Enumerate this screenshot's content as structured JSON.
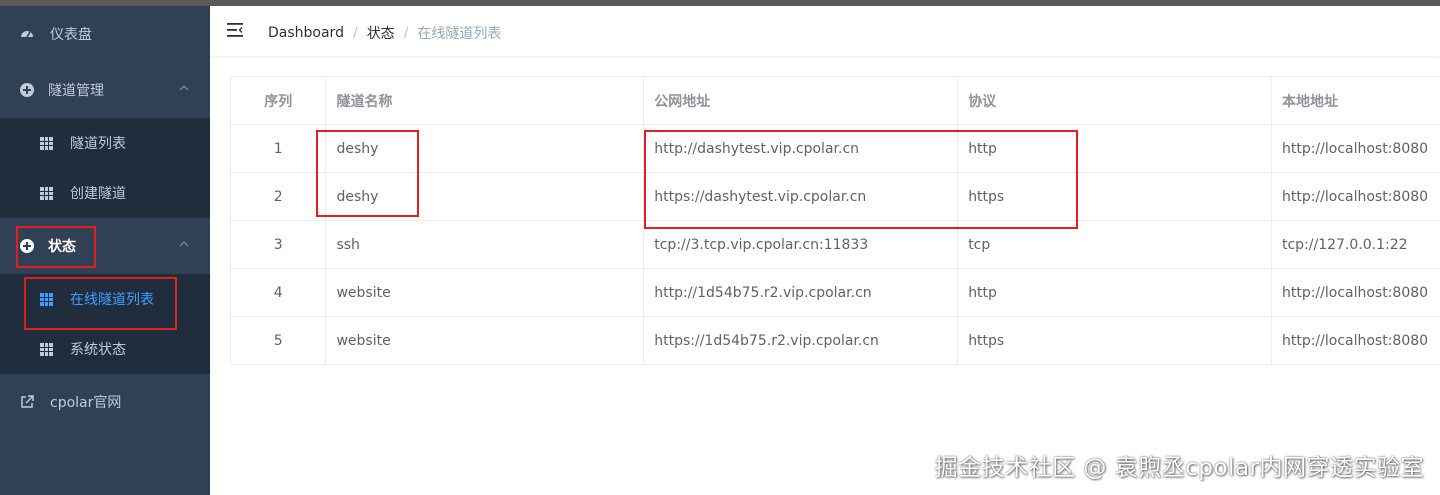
{
  "sidebar": {
    "dashboard": "仪表盘",
    "tunnel_mgmt": "隧道管理",
    "tunnel_list": "隧道列表",
    "create_tunnel": "创建隧道",
    "status": "状态",
    "online_tunnels": "在线隧道列表",
    "system_status": "系统状态",
    "cpolar_site": "cpolar官网"
  },
  "breadcrumb": {
    "home": "Dashboard",
    "sep": "/",
    "level1": "状态",
    "current": "在线隧道列表"
  },
  "table": {
    "headers": [
      "序列",
      "隧道名称",
      "公网地址",
      "协议",
      "本地地址"
    ],
    "rows": [
      [
        "1",
        "deshy",
        "http://dashytest.vip.cpolar.cn",
        "http",
        "http://localhost:8080"
      ],
      [
        "2",
        "deshy",
        "https://dashytest.vip.cpolar.cn",
        "https",
        "http://localhost:8080"
      ],
      [
        "3",
        "ssh",
        "tcp://3.tcp.vip.cpolar.cn:11833",
        "tcp",
        "tcp://127.0.0.1:22"
      ],
      [
        "4",
        "website",
        "http://1d54b75.r2.vip.cpolar.cn",
        "http",
        "http://localhost:8080"
      ],
      [
        "5",
        "website",
        "https://1d54b75.r2.vip.cpolar.cn",
        "https",
        "http://localhost:8080"
      ]
    ]
  },
  "watermark": "掘金技术社区 @ 袁煦丞cpolar内网穿透实验室",
  "colors": {
    "sidebar_bg": "#304156",
    "submenu_bg": "#1f2d3d",
    "active": "#409eff",
    "annotation": "#e02020"
  }
}
